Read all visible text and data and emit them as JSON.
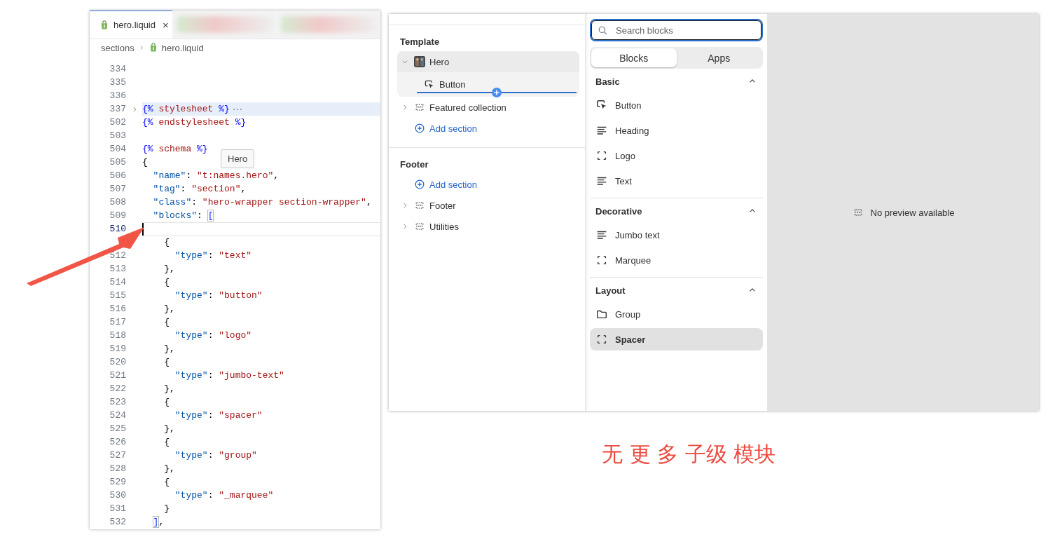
{
  "editor": {
    "tab": {
      "label": "hero.liquid",
      "close": "×"
    },
    "breadcrumb": [
      "sections",
      "hero.liquid"
    ],
    "tooltip": "Hero",
    "lines": [
      {
        "number": "334"
      },
      {
        "number": "335"
      },
      {
        "number": "336"
      },
      {
        "number": "337",
        "folded": true,
        "highlighted": true,
        "tokens": [
          {
            "kind": "delim",
            "text": "{%"
          },
          {
            "kind": "word",
            "text": " stylesheet "
          },
          {
            "kind": "delim",
            "text": "%}"
          }
        ]
      },
      {
        "number": "502",
        "tokens": [
          {
            "kind": "delim",
            "text": "{%"
          },
          {
            "kind": "word",
            "text": " endstylesheet "
          },
          {
            "kind": "delim",
            "text": "%}"
          }
        ]
      },
      {
        "number": "503"
      },
      {
        "number": "504",
        "tokens": [
          {
            "kind": "delim",
            "text": "{%"
          },
          {
            "kind": "word",
            "text": " schema "
          },
          {
            "kind": "delim",
            "text": "%}"
          }
        ]
      },
      {
        "number": "505",
        "tokens": [
          {
            "kind": "punct",
            "text": "{"
          }
        ]
      },
      {
        "number": "506",
        "tokens": [
          {
            "kind": "key",
            "text": "  \"name\""
          },
          {
            "kind": "punct",
            "text": ": "
          },
          {
            "kind": "str",
            "text": "\"t:names.hero\""
          },
          {
            "kind": "punct",
            "text": ","
          }
        ]
      },
      {
        "number": "507",
        "tokens": [
          {
            "kind": "key",
            "text": "  \"tag\""
          },
          {
            "kind": "punct",
            "text": ": "
          },
          {
            "kind": "str",
            "text": "\"section\""
          },
          {
            "kind": "punct",
            "text": ","
          }
        ]
      },
      {
        "number": "508",
        "tokens": [
          {
            "kind": "key",
            "text": "  \"class\""
          },
          {
            "kind": "punct",
            "text": ": "
          },
          {
            "kind": "str",
            "text": "\"hero-wrapper section-wrapper\""
          },
          {
            "kind": "punct",
            "text": ","
          }
        ]
      },
      {
        "number": "509",
        "tokens": [
          {
            "kind": "key",
            "text": "  \"blocks\""
          },
          {
            "kind": "punct",
            "text": ": "
          },
          {
            "kind": "bracket",
            "text": "["
          }
        ]
      },
      {
        "number": "510",
        "current": true
      },
      {
        "tokens": [
          {
            "kind": "punct",
            "text": "    {"
          }
        ]
      },
      {
        "number": "512",
        "tokens": [
          {
            "kind": "key",
            "text": "      \"type\""
          },
          {
            "kind": "punct",
            "text": ": "
          },
          {
            "kind": "str",
            "text": "\"text\""
          }
        ]
      },
      {
        "number": "513",
        "tokens": [
          {
            "kind": "punct",
            "text": "    },"
          }
        ]
      },
      {
        "number": "514",
        "tokens": [
          {
            "kind": "punct",
            "text": "    {"
          }
        ]
      },
      {
        "number": "515",
        "tokens": [
          {
            "kind": "key",
            "text": "      \"type\""
          },
          {
            "kind": "punct",
            "text": ": "
          },
          {
            "kind": "str",
            "text": "\"button\""
          }
        ]
      },
      {
        "number": "516",
        "tokens": [
          {
            "kind": "punct",
            "text": "    },"
          }
        ]
      },
      {
        "number": "517",
        "tokens": [
          {
            "kind": "punct",
            "text": "    {"
          }
        ]
      },
      {
        "number": "518",
        "tokens": [
          {
            "kind": "key",
            "text": "      \"type\""
          },
          {
            "kind": "punct",
            "text": ": "
          },
          {
            "kind": "str",
            "text": "\"logo\""
          }
        ]
      },
      {
        "number": "519",
        "tokens": [
          {
            "kind": "punct",
            "text": "    },"
          }
        ]
      },
      {
        "number": "520",
        "tokens": [
          {
            "kind": "punct",
            "text": "    {"
          }
        ]
      },
      {
        "number": "521",
        "tokens": [
          {
            "kind": "key",
            "text": "      \"type\""
          },
          {
            "kind": "punct",
            "text": ": "
          },
          {
            "kind": "str",
            "text": "\"jumbo-text\""
          }
        ]
      },
      {
        "number": "522",
        "tokens": [
          {
            "kind": "punct",
            "text": "    },"
          }
        ]
      },
      {
        "number": "523",
        "tokens": [
          {
            "kind": "punct",
            "text": "    {"
          }
        ]
      },
      {
        "number": "524",
        "tokens": [
          {
            "kind": "key",
            "text": "      \"type\""
          },
          {
            "kind": "punct",
            "text": ": "
          },
          {
            "kind": "str",
            "text": "\"spacer\""
          }
        ]
      },
      {
        "number": "525",
        "tokens": [
          {
            "kind": "punct",
            "text": "    },"
          }
        ]
      },
      {
        "number": "526",
        "tokens": [
          {
            "kind": "punct",
            "text": "    {"
          }
        ]
      },
      {
        "number": "527",
        "tokens": [
          {
            "kind": "key",
            "text": "      \"type\""
          },
          {
            "kind": "punct",
            "text": ": "
          },
          {
            "kind": "str",
            "text": "\"group\""
          }
        ]
      },
      {
        "number": "528",
        "tokens": [
          {
            "kind": "punct",
            "text": "    },"
          }
        ]
      },
      {
        "number": "529",
        "tokens": [
          {
            "kind": "punct",
            "text": "    {"
          }
        ]
      },
      {
        "number": "530",
        "tokens": [
          {
            "kind": "key",
            "text": "      \"type\""
          },
          {
            "kind": "punct",
            "text": ": "
          },
          {
            "kind": "str",
            "text": "\"_marquee\""
          }
        ]
      },
      {
        "number": "531",
        "tokens": [
          {
            "kind": "punct",
            "text": "    }"
          }
        ]
      },
      {
        "number": "532",
        "tokens": [
          {
            "kind": "bracket",
            "text": "  ]"
          },
          {
            "kind": "punct",
            "text": ","
          }
        ]
      }
    ]
  },
  "sidebar": {
    "groups": [
      {
        "title": "Template",
        "items": [
          {
            "label": "Hero",
            "kind": "section",
            "expanded": true,
            "selected": true,
            "children": [
              {
                "label": "Button",
                "kind": "block"
              }
            ]
          },
          {
            "label": "Featured collection",
            "kind": "section",
            "expanded": false,
            "selected": false
          },
          {
            "label": "Add section",
            "kind": "add"
          }
        ]
      },
      {
        "title": "Footer",
        "items": [
          {
            "label": "Add section",
            "kind": "add"
          },
          {
            "label": "Footer",
            "kind": "section",
            "expanded": false,
            "selected": false
          },
          {
            "label": "Utilities",
            "kind": "section",
            "expanded": false,
            "selected": false
          }
        ]
      }
    ]
  },
  "picker": {
    "search": {
      "placeholder": "Search blocks"
    },
    "tabs": [
      {
        "label": "Blocks",
        "selected": true
      },
      {
        "label": "Apps",
        "selected": false
      }
    ],
    "categories": [
      {
        "title": "Basic",
        "expanded": true,
        "items": [
          {
            "label": "Button",
            "kind": "button",
            "selected": false
          },
          {
            "label": "Heading",
            "kind": "lines",
            "selected": false
          },
          {
            "label": "Logo",
            "kind": "frame",
            "selected": false
          },
          {
            "label": "Text",
            "kind": "lines",
            "selected": false
          }
        ]
      },
      {
        "title": "Decorative",
        "expanded": true,
        "items": [
          {
            "label": "Jumbo text",
            "kind": "lines",
            "selected": false
          },
          {
            "label": "Marquee",
            "kind": "frame",
            "selected": false
          }
        ]
      },
      {
        "title": "Layout",
        "expanded": true,
        "items": [
          {
            "label": "Group",
            "kind": "folder",
            "selected": false
          },
          {
            "label": "Spacer",
            "kind": "frame",
            "selected": true
          }
        ]
      }
    ]
  },
  "preview": {
    "message": "No preview available"
  },
  "annotation": {
    "text": "无 更 多 子级 模块"
  }
}
